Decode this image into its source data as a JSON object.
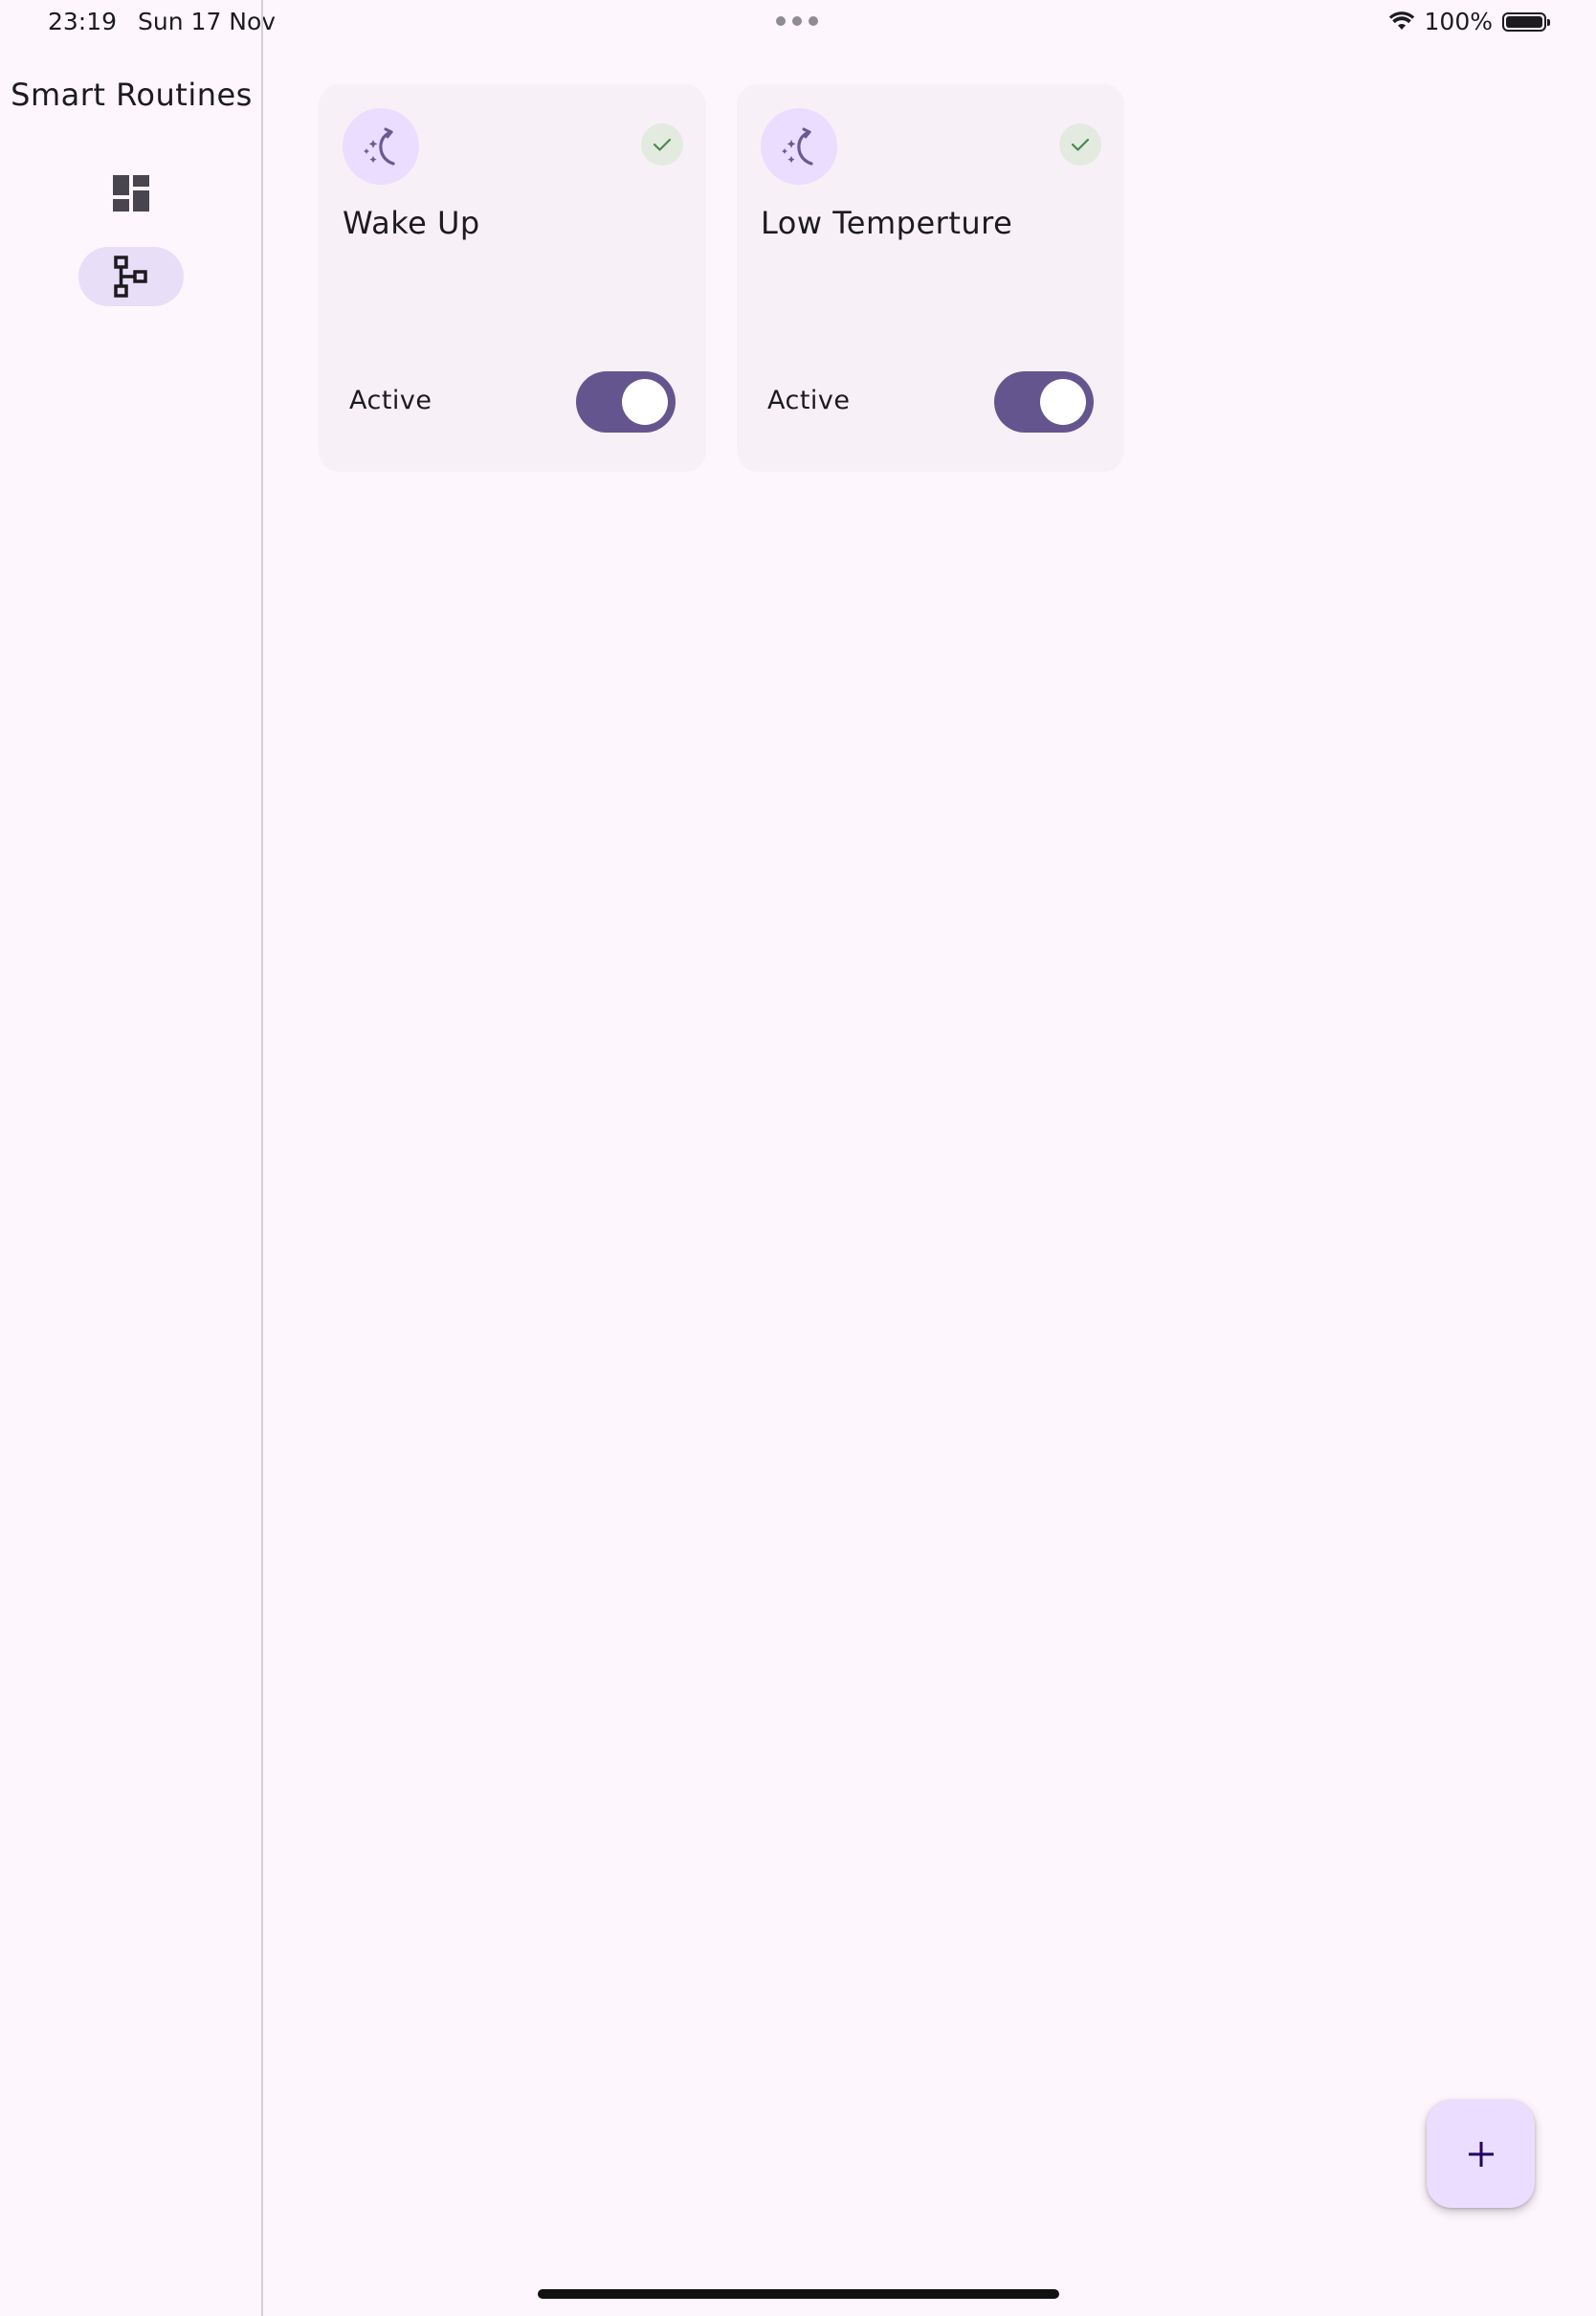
{
  "status_bar": {
    "time": "23:19",
    "date": "Sun 17 Nov",
    "battery": "100%",
    "wifi_icon": "wifi-icon",
    "battery_icon": "battery-icon"
  },
  "nav_rail": {
    "title": "Smart Routines",
    "items": [
      {
        "icon": "dashboard-icon",
        "selected": false
      },
      {
        "icon": "account-tree-icon",
        "selected": true
      }
    ]
  },
  "routines": [
    {
      "title": "Wake Up",
      "status_label": "Active",
      "enabled": true,
      "icon": "night-sight-auto-icon",
      "status_icon": "check-icon"
    },
    {
      "title": "Low Temperture",
      "status_label": "Active",
      "enabled": true,
      "icon": "night-sight-auto-icon",
      "status_icon": "check-icon"
    }
  ],
  "fab": {
    "icon": "add-icon"
  },
  "colors": {
    "background": "#fdf7fd",
    "card": "#f7f1f7",
    "primary": "#65558f",
    "secondary_container": "#e8def8",
    "primary_container": "#eaddff",
    "success": "#4a8a4f"
  }
}
